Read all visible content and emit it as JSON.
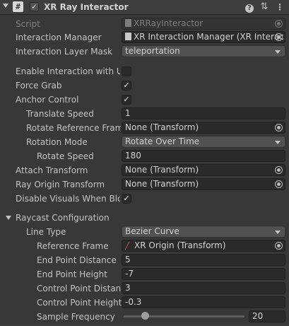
{
  "header": {
    "title": "XR Ray Interactor",
    "script_glyph": "#",
    "enabled_check": "✓",
    "help_glyph": "?",
    "presets_glyph": "⇅",
    "menu_glyph": "⋮"
  },
  "fields": {
    "script": {
      "label": "Script",
      "value": "XRRayInteractor"
    },
    "interaction_manager": {
      "label": "Interaction Manager",
      "value": "XR Interaction Manager (XR Interac"
    },
    "interaction_layer_mask": {
      "label": "Interaction Layer Mask",
      "value": "teleportation"
    },
    "enable_ui": {
      "label": "Enable Interaction with UI G",
      "checked": false
    },
    "force_grab": {
      "label": "Force Grab",
      "checked": true
    },
    "anchor_control": {
      "label": "Anchor Control",
      "checked": true
    },
    "translate_speed": {
      "label": "Translate Speed",
      "value": "1"
    },
    "rotate_reference_frame": {
      "label": "Rotate Reference Frame",
      "value": "None (Transform)"
    },
    "rotation_mode": {
      "label": "Rotation Mode",
      "value": "Rotate Over Time"
    },
    "rotate_speed": {
      "label": "Rotate Speed",
      "value": "180"
    },
    "attach_transform": {
      "label": "Attach Transform",
      "value": "None (Transform)"
    },
    "ray_origin_transform": {
      "label": "Ray Origin Transform",
      "value": "None (Transform)"
    },
    "disable_visuals": {
      "label": "Disable Visuals When Bloc",
      "checked": true
    }
  },
  "raycast": {
    "section_label": "Raycast Configuration",
    "line_type": {
      "label": "Line Type",
      "value": "Bezier Curve"
    },
    "reference_frame": {
      "label": "Reference Frame",
      "value": "XR Origin (Transform)"
    },
    "end_point_distance": {
      "label": "End Point Distance",
      "value": "5"
    },
    "end_point_height": {
      "label": "End Point Height",
      "value": "-7"
    },
    "control_point_distance": {
      "label": "Control Point Distanc",
      "value": "3"
    },
    "control_point_height": {
      "label": "Control Point Height",
      "value": "-0.3"
    },
    "sample_frequency": {
      "label": "Sample Frequency",
      "value": "20",
      "slider_fraction": 0.18
    }
  },
  "check_glyph": "✓",
  "colors": {
    "background": "#383838",
    "field": "#2a2a2a",
    "dropdown": "#515151",
    "text": "#c4c4c4"
  }
}
